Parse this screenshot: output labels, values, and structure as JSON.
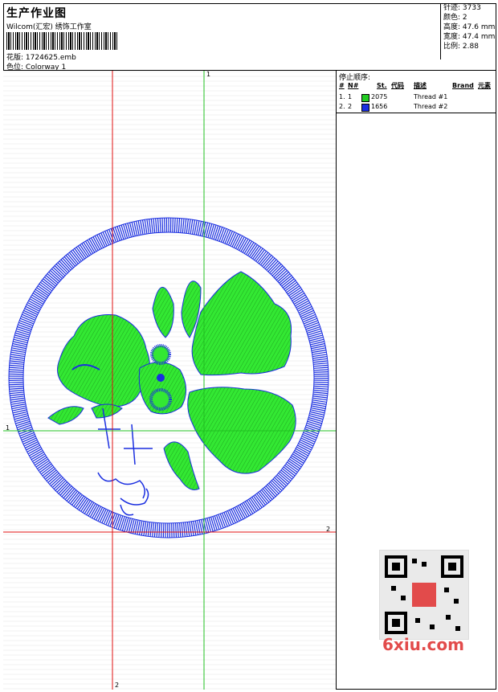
{
  "header": {
    "title": "生产作业图",
    "company": "Wilcom(汇宏) 绣饰工作室",
    "design_label": "花版:",
    "design_value": "1724625.emb",
    "colorway_label": "色位:",
    "colorway_value": "Colorway 1"
  },
  "stats": [
    {
      "label": "针迹:",
      "value": "3733"
    },
    {
      "label": "颜色:",
      "value": "2"
    },
    {
      "label": "高度:",
      "value": "47.6 mm"
    },
    {
      "label": "宽度:",
      "value": "47.4 mm"
    },
    {
      "label": "比例:",
      "value": "2.88"
    }
  ],
  "stop_sequence": {
    "heading": "停止顺序:",
    "columns": [
      "#",
      "N#",
      "St.",
      "代码",
      "描述",
      "Brand",
      "元素"
    ],
    "rows": [
      {
        "num": "1.",
        "n": "1",
        "color": "#22cc22",
        "code": "2075",
        "description": "Thread #1"
      },
      {
        "num": "2.",
        "n": "2",
        "color": "#1a2ee0",
        "code": "1656",
        "description": "Thread #2"
      }
    ]
  },
  "guides": {
    "green_top": "1",
    "green_left": "1",
    "red_right": "2",
    "red_bottom": "2"
  },
  "colors": {
    "fill_green": "#33e833",
    "outline_blue": "#1a2ee0",
    "guide_red": "#e01010",
    "guide_green": "#20c020"
  },
  "watermark": "6xiu.com"
}
